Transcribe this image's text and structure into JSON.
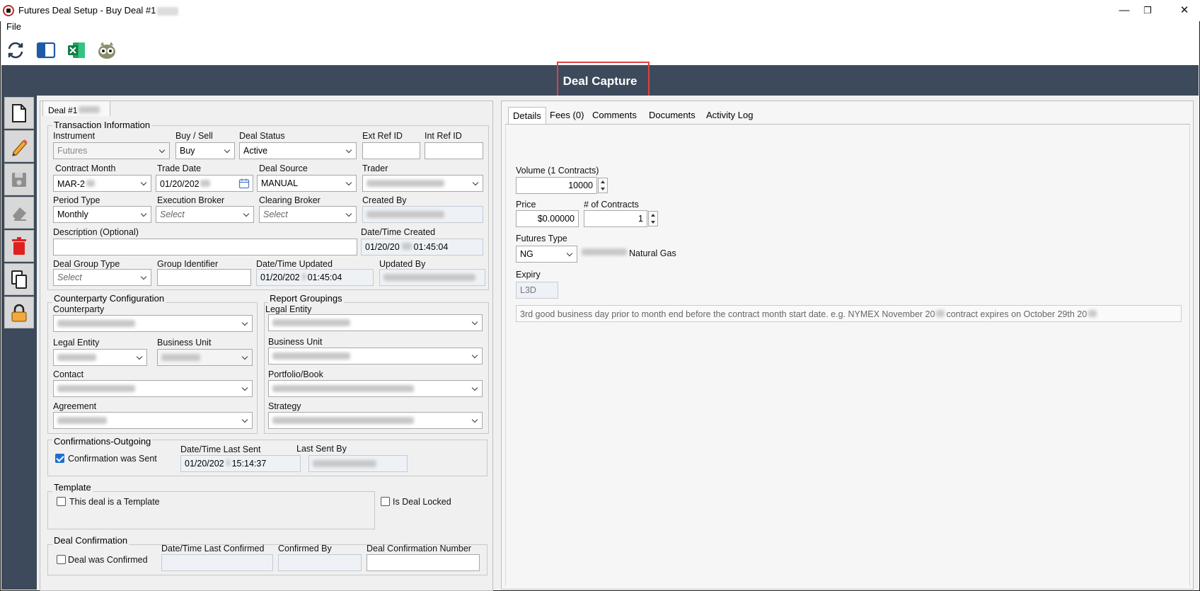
{
  "window": {
    "title": "Futures Deal Setup - Buy Deal #1",
    "minimize": "—",
    "restore": "❐",
    "close": "✕"
  },
  "menu": {
    "file": "File"
  },
  "toolbar": {
    "icons": [
      "refresh-icon",
      "panel-icon",
      "excel-icon",
      "app-mascot-icon"
    ]
  },
  "header": {
    "title": "Deal Capture"
  },
  "sidebar": {
    "icons": [
      "new-document-icon",
      "edit-pencil-icon",
      "save-icon",
      "eraser-icon",
      "delete-trash-icon",
      "copy-icon",
      "lock-icon"
    ]
  },
  "deal_tab": {
    "label": "Deal #1"
  },
  "transaction": {
    "title": "Transaction Information",
    "instrument_label": "Instrument",
    "instrument_value": "Futures",
    "buysell_label": "Buy / Sell",
    "buysell_value": "Buy",
    "status_label": "Deal Status",
    "status_value": "Active",
    "ext_ref_label": "Ext Ref ID",
    "int_ref_label": "Int Ref ID",
    "contract_month_label": "Contract Month",
    "contract_month_value": "MAR-2",
    "trade_date_label": "Trade Date",
    "trade_date_value": "01/20/202",
    "deal_source_label": "Deal Source",
    "deal_source_value": "MANUAL",
    "trader_label": "Trader",
    "period_type_label": "Period Type",
    "period_type_value": "Monthly",
    "exec_broker_label": "Execution Broker",
    "exec_broker_value": "Select",
    "clearing_broker_label": "Clearing Broker",
    "clearing_broker_value": "Select",
    "created_by_label": "Created By",
    "description_label": "Description (Optional)",
    "created_dt_label": "Date/Time Created",
    "created_dt_value": "01/20/20",
    "created_time": "01:45:04",
    "group_type_label": "Deal Group Type",
    "group_type_value": "Select",
    "group_id_label": "Group Identifier",
    "updated_dt_label": "Date/Time Updated",
    "updated_dt_value": "01/20/202",
    "updated_time": "01:45:04",
    "updated_by_label": "Updated By"
  },
  "counterparty": {
    "title": "Counterparty Configuration",
    "counterparty_label": "Counterparty",
    "legal_entity_label": "Legal Entity",
    "business_unit_label": "Business Unit",
    "contact_label": "Contact",
    "agreement_label": "Agreement"
  },
  "report": {
    "title": "Report Groupings",
    "legal_entity_label": "Legal Entity",
    "business_unit_label": "Business Unit",
    "portfolio_label": "Portfolio/Book",
    "strategy_label": "Strategy"
  },
  "confirmations": {
    "title": "Confirmations-Outgoing",
    "sent_label": "Confirmation was Sent",
    "last_sent_label": "Date/Time Last Sent",
    "last_sent_value": "01/20/202",
    "last_sent_time": "15:14:37",
    "last_sent_by_label": "Last Sent By"
  },
  "template": {
    "title": "Template",
    "is_template_label": "This deal is a Template",
    "locked_label": "Is Deal Locked"
  },
  "deal_confirmation": {
    "title": "Deal Confirmation",
    "confirmed_label": "Deal was Confirmed",
    "last_confirmed_label": "Date/Time Last Confirmed",
    "confirmed_by_label": "Confirmed By",
    "number_label": "Deal Confirmation Number"
  },
  "details": {
    "tabs": [
      "Details",
      "Fees (0)",
      "Comments",
      "Documents",
      "Activity Log"
    ],
    "volume_label": "Volume (1 Contracts)",
    "volume_value": "10000",
    "price_label": "Price",
    "price_value": "$0.00000",
    "contracts_label": "# of Contracts",
    "contracts_value": "1",
    "futures_type_label": "Futures Type",
    "futures_type_value": "NG",
    "futures_type_desc": "Natural Gas",
    "expiry_label": "Expiry",
    "expiry_value": "L3D",
    "expiry_desc_a": "3rd good business day prior to month end before the contract month start date. e.g. NYMEX November 20",
    "expiry_desc_b": "contract expires on October 29th 20"
  }
}
